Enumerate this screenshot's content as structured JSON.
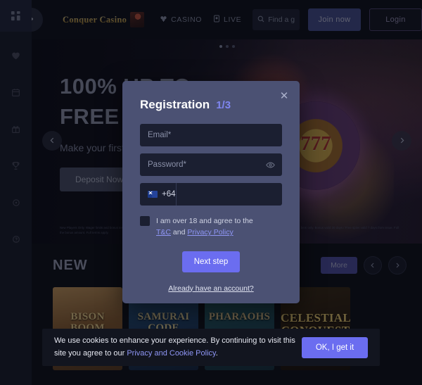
{
  "sidebar": {
    "toggle_icon": "apps-grid-icon",
    "expand_icon": "chevron-right-icon",
    "items": [
      {
        "icon": "heart-icon",
        "name": "favorites"
      },
      {
        "icon": "calendar-icon",
        "name": "tournaments"
      },
      {
        "icon": "gift-icon",
        "name": "bonuses"
      },
      {
        "icon": "trophy-icon",
        "name": "rewards"
      },
      {
        "icon": "circle-icon",
        "name": "promotions"
      },
      {
        "icon": "help-icon",
        "name": "support"
      }
    ]
  },
  "header": {
    "logo_text": "Conquer Casino",
    "nav": [
      {
        "label": "CASINO",
        "icon": "clover-icon"
      },
      {
        "label": "LIVE",
        "icon": "live-dealer-icon"
      }
    ],
    "search": {
      "placeholder": "Find a ga...",
      "value": "",
      "icon": "search-icon"
    },
    "join_label": "Join now",
    "login_label": "Login"
  },
  "hero": {
    "line1": "100% UP TO",
    "line2": "FREE SPINS",
    "subtitle": "Make your first deposit",
    "cta_label": "Deposit Now",
    "fine_left": "New Players Only. Wager limits and bonus terms apply. Min deposit required on receipt. Max conversion: 3 times the bonus amount. Full terms apply.",
    "fine_right": "Eligibility restrictions apply. Real money bets only. Bonus valid 30 days / Free spins valid 7 days from issue. Full terms apply.",
    "prev_icon": "chevron-left-icon",
    "next_icon": "chevron-right-icon"
  },
  "section": {
    "title": "NEW",
    "more_label": "More",
    "prev_icon": "chevron-left-icon",
    "next_icon": "chevron-right-icon",
    "tiles": [
      {
        "title": "BISON BOOM"
      },
      {
        "title": "SAMURAI CODE"
      },
      {
        "title": "PHARAOHS"
      },
      {
        "title": "CELESTIAL CONQUEST"
      }
    ]
  },
  "modal": {
    "title": "Registration",
    "step": "1/3",
    "close_icon": "close-icon",
    "email": {
      "placeholder": "Email*",
      "value": ""
    },
    "password": {
      "placeholder": "Password*",
      "value": "",
      "toggle_icon": "eye-icon"
    },
    "phone": {
      "country_code": "+64",
      "flag": "nz-flag-icon",
      "placeholder": "",
      "value": ""
    },
    "agree_prefix": "I am over 18 and agree to the",
    "agree_link1": "T&C",
    "agree_middle": "and",
    "agree_link2": "Privacy Policy",
    "next_label": "Next step",
    "login_link": "Already have an account?"
  },
  "cookie": {
    "text_1": "We use cookies to enhance your experience. By continuing to visit this site you agree to our ",
    "link": "Privacy and Cookie Policy",
    "text_2": ".",
    "accept_label": "OK, I get it"
  },
  "colors": {
    "accent": "#6b6df0",
    "modal_bg": "#4b5173",
    "page_bg": "#0c0e16",
    "sidebar_bg": "#181b29",
    "gold": "#c9a44c"
  }
}
